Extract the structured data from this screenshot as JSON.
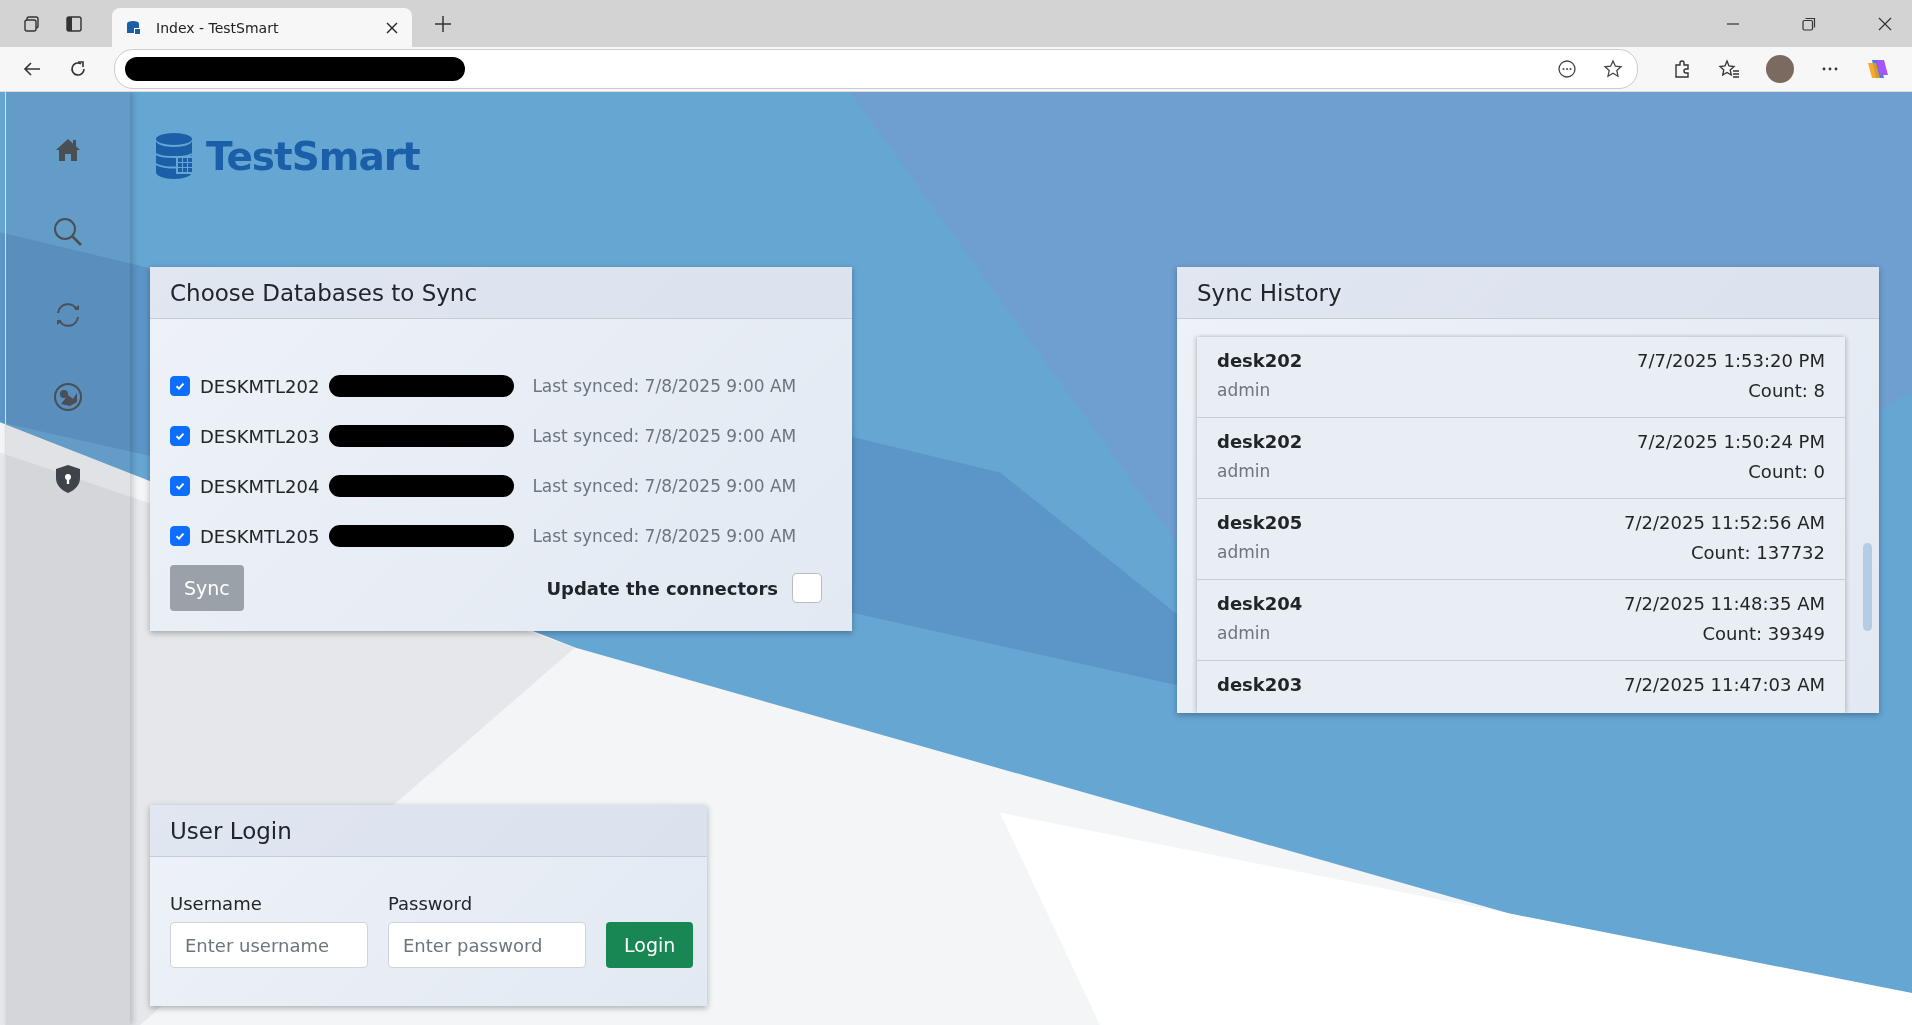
{
  "browser": {
    "tab_title": "Index - TestSmart"
  },
  "logo": {
    "text": "TestSmart"
  },
  "sync_panel": {
    "title": "Choose Databases to Sync",
    "databases": [
      {
        "name": "DESKMTL202",
        "checked": true,
        "last_synced": "Last synced: 7/8/2025 9:00 AM"
      },
      {
        "name": "DESKMTL203",
        "checked": true,
        "last_synced": "Last synced: 7/8/2025 9:00 AM"
      },
      {
        "name": "DESKMTL204",
        "checked": true,
        "last_synced": "Last synced: 7/8/2025 9:00 AM"
      },
      {
        "name": "DESKMTL205",
        "checked": true,
        "last_synced": "Last synced: 7/8/2025 9:00 AM"
      }
    ],
    "sync_button": "Sync",
    "update_connectors": {
      "label": "Update the connectors",
      "checked": false
    }
  },
  "history": {
    "title": "Sync History",
    "entries": [
      {
        "name": "desk202",
        "time": "7/7/2025 1:53:20 PM",
        "user": "admin",
        "count": "Count: 8"
      },
      {
        "name": "desk202",
        "time": "7/2/2025 1:50:24 PM",
        "user": "admin",
        "count": "Count: 0"
      },
      {
        "name": "desk205",
        "time": "7/2/2025 11:52:56 AM",
        "user": "admin",
        "count": "Count: 137732"
      },
      {
        "name": "desk204",
        "time": "7/2/2025 11:48:35 AM",
        "user": "admin",
        "count": "Count: 39349"
      },
      {
        "name": "desk203",
        "time": "7/2/2025 11:47:03 AM"
      }
    ]
  },
  "login": {
    "title": "User Login",
    "username": {
      "label": "Username",
      "placeholder": "Enter username"
    },
    "password": {
      "label": "Password",
      "placeholder": "Enter password"
    },
    "button": "Login"
  }
}
